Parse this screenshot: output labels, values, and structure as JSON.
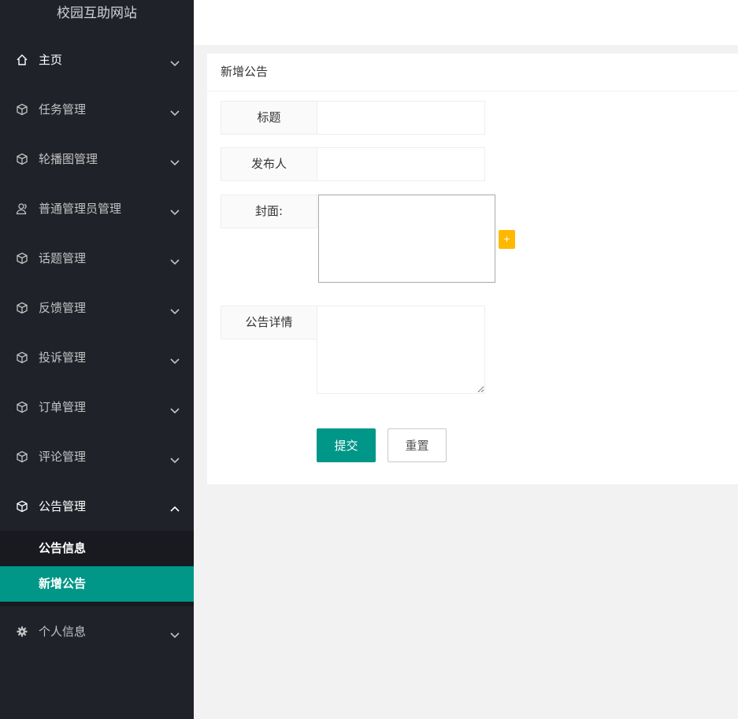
{
  "app": {
    "title": "校园互助网站"
  },
  "sidebar": {
    "items": [
      {
        "label": "主页",
        "icon": "home-icon"
      },
      {
        "label": "任务管理",
        "icon": "cube-icon"
      },
      {
        "label": "轮播图管理",
        "icon": "cube-icon"
      },
      {
        "label": "普通管理员管理",
        "icon": "user-icon"
      },
      {
        "label": "话题管理",
        "icon": "cube-icon"
      },
      {
        "label": "反馈管理",
        "icon": "cube-icon"
      },
      {
        "label": "投诉管理",
        "icon": "cube-icon"
      },
      {
        "label": "订单管理",
        "icon": "cube-icon"
      },
      {
        "label": "评论管理",
        "icon": "cube-icon"
      },
      {
        "label": "公告管理",
        "icon": "cube-icon",
        "expanded": true,
        "children": [
          {
            "label": "公告信息"
          },
          {
            "label": "新增公告",
            "active": true
          }
        ]
      },
      {
        "label": "个人信息",
        "icon": "gear-icon"
      }
    ]
  },
  "form": {
    "heading": "新增公告",
    "title_label": "标题",
    "title_value": "",
    "publisher_label": "发布人",
    "publisher_value": "",
    "cover_label": "封面:",
    "add_cover": "+",
    "detail_label": "公告详情",
    "detail_value": "",
    "submit_label": "提交",
    "reset_label": "重置"
  },
  "colors": {
    "sidebar_bg": "#20222a",
    "accent": "#009688",
    "upload_button": "#ffb800"
  }
}
